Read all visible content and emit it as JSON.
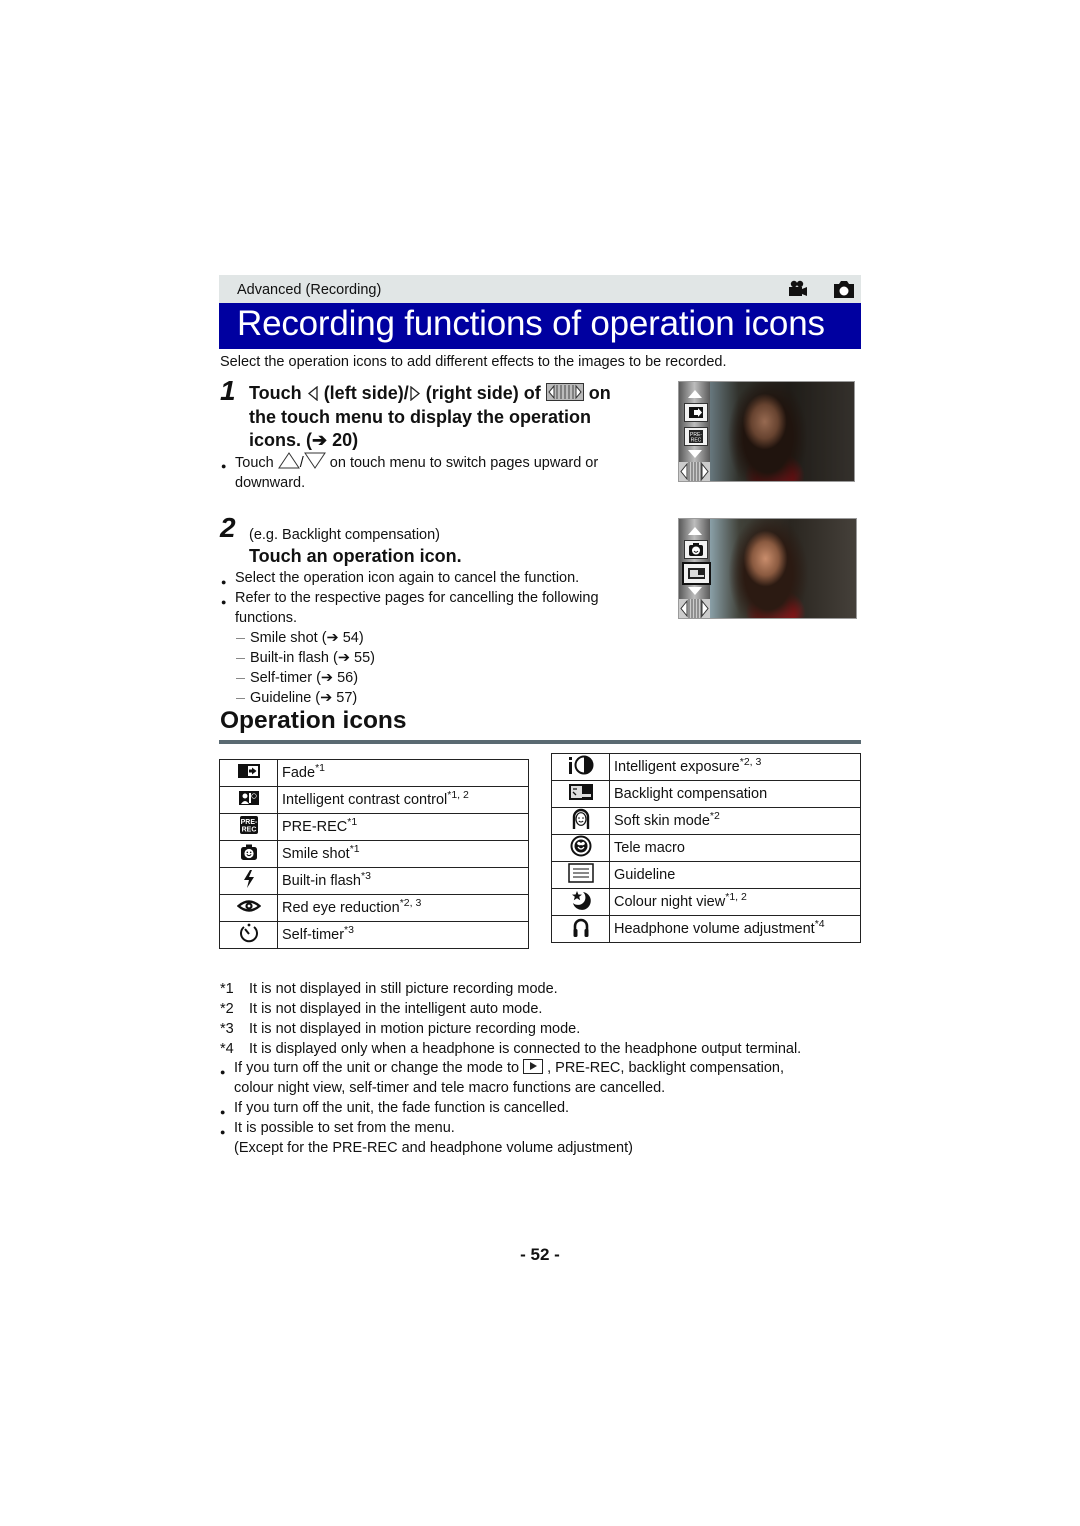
{
  "header": {
    "breadcrumb": "Advanced (Recording)",
    "mode_icons": [
      "motion-picture-mode-icon",
      "still-picture-mode-icon"
    ],
    "title": "Recording functions of operation icons",
    "title_bar_color": "#0000a0",
    "intro": "Select the operation icons to add different effects to the images to be recorded."
  },
  "step1": {
    "number": "1",
    "heading_part1": "Touch",
    "heading_part2": "(left side)/",
    "heading_part3": "(right side) of",
    "heading_part4": "on",
    "heading_line2": "the touch menu to display the operation",
    "heading_line3": "icons. (➔ 20)",
    "bullet_touch": "Touch",
    "bullet_rest": "on touch menu to switch pages upward or",
    "bullet_line2": "downward."
  },
  "step2": {
    "number": "2",
    "example": "(e.g. Backlight compensation)",
    "heading": "Touch an operation icon.",
    "bullets": [
      "Select the operation icon again to cancel the function.",
      "Refer to the respective pages for cancelling the following"
    ],
    "bullet2_line2": "functions.",
    "refs": [
      "Smile shot (➔ 54)",
      "Built-in flash (➔ 55)",
      "Self-timer (➔ 56)",
      "Guideline (➔ 57)"
    ]
  },
  "section": {
    "heading": "Operation icons"
  },
  "table_left": [
    {
      "icon": "fade-icon",
      "label": "Fade",
      "note": "*1"
    },
    {
      "icon": "intelligent-contrast-icon",
      "label": "Intelligent contrast control",
      "note": "*1, 2"
    },
    {
      "icon": "pre-rec-icon",
      "label": "PRE-REC",
      "note": "*1"
    },
    {
      "icon": "smile-shot-icon",
      "label": "Smile shot",
      "note": "*1"
    },
    {
      "icon": "flash-icon",
      "label": "Built-in flash",
      "note": "*3"
    },
    {
      "icon": "red-eye-icon",
      "label": "Red eye reduction",
      "note": "*2, 3"
    },
    {
      "icon": "self-timer-icon",
      "label": "Self-timer",
      "note": "*3"
    }
  ],
  "table_right": [
    {
      "icon": "intelligent-exposure-icon",
      "label": "Intelligent exposure",
      "note": "*2, 3"
    },
    {
      "icon": "backlight-icon",
      "label": "Backlight compensation",
      "note": ""
    },
    {
      "icon": "soft-skin-icon",
      "label": "Soft skin mode",
      "note": "*2"
    },
    {
      "icon": "tele-macro-icon",
      "label": "Tele macro",
      "note": ""
    },
    {
      "icon": "guideline-icon",
      "label": "Guideline",
      "note": ""
    },
    {
      "icon": "colour-night-view-icon",
      "label": "Colour night view",
      "note": "*1, 2"
    },
    {
      "icon": "headphone-icon",
      "label": "Headphone volume adjustment",
      "note": "*4"
    }
  ],
  "footnotes": [
    {
      "mark": "*1",
      "text": "It is not displayed in still picture recording mode."
    },
    {
      "mark": "*2",
      "text": "It is not displayed in the intelligent auto mode."
    },
    {
      "mark": "*3",
      "text": "It is not displayed in motion picture recording mode."
    },
    {
      "mark": "*4",
      "text": "It is displayed only when a headphone is connected to the headphone output terminal."
    }
  ],
  "notes": {
    "n1_part1": "If you turn off the unit or change the mode to",
    "n1_part2": ", PRE-REC, backlight compensation,",
    "n1_line2": "colour night view, self-timer and tele macro functions are cancelled.",
    "n2": "If you turn off the unit, the fade function is cancelled.",
    "n3": "It is possible to set from the menu.",
    "n3_line2": "(Except for the PRE-REC and headphone volume adjustment)"
  },
  "page_number": "- 52 -"
}
